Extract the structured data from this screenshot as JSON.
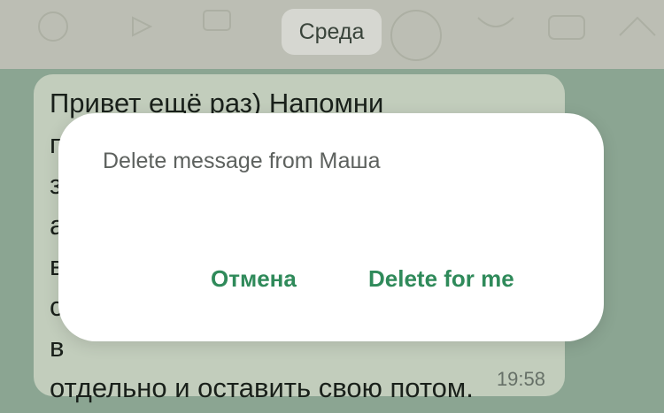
{
  "date_chip": "Среда",
  "message": {
    "text": "Привет ещё раз) Напомни\nп\nз\nа\nв\nс\nв\nотдельно и оставить свою потом.",
    "time": "19:58"
  },
  "dialog": {
    "title": "Delete message from Маша",
    "cancel_label": "Отмена",
    "delete_label": "Delete for me"
  },
  "colors": {
    "accent": "#2f8a5a",
    "selection": "#97b39f",
    "bubble": "#d3dfcd",
    "wallpaper": "#cdcfc4"
  }
}
